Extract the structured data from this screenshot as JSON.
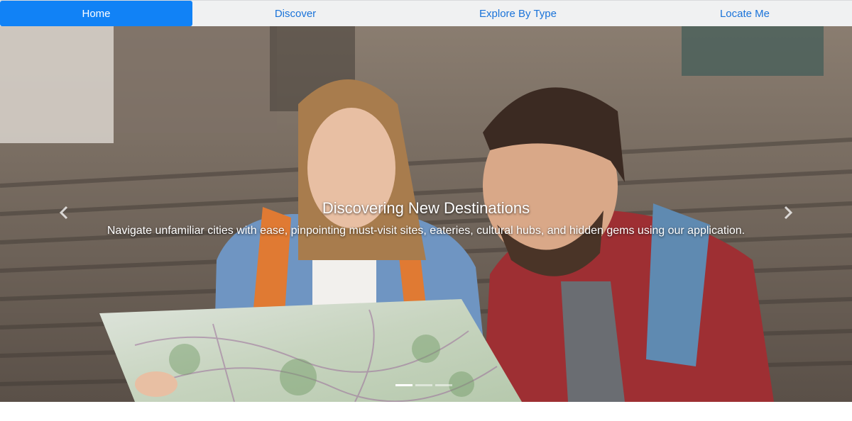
{
  "nav": {
    "items": [
      {
        "label": "Home",
        "active": true
      },
      {
        "label": "Discover",
        "active": false
      },
      {
        "label": "Explore By Type",
        "active": false
      },
      {
        "label": "Locate Me",
        "active": false
      }
    ],
    "active_color": "#1182f6",
    "link_color": "#1a73d9"
  },
  "carousel": {
    "slide": {
      "title": "Discovering New Destinations",
      "text": "Navigate unfamiliar cities with ease, pinpointing must-visit sites, eateries, cultural hubs, and hidden gems using our application."
    },
    "prev_icon": "chevron-left-icon",
    "next_icon": "chevron-right-icon",
    "indicator_count": 3,
    "active_indicator": 1
  }
}
